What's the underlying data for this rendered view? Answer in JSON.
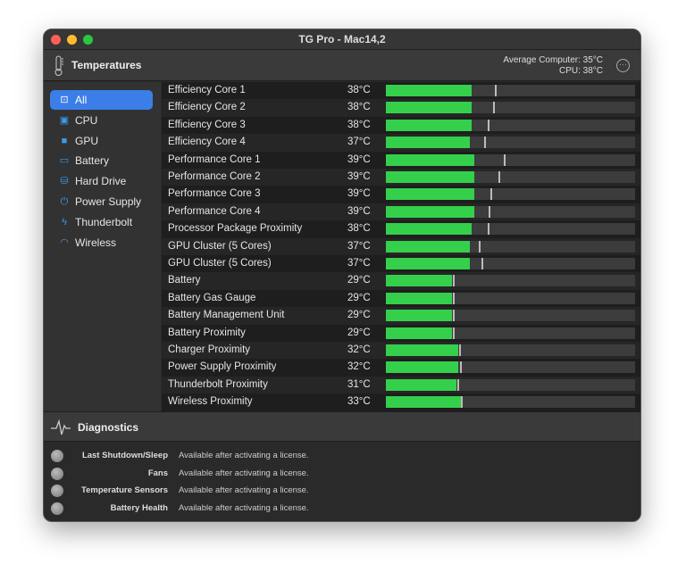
{
  "window": {
    "title": "TG Pro - Mac14,2"
  },
  "header": {
    "title": "Temperatures",
    "avg_label": "Average Computer:",
    "avg_value": "35°C",
    "cpu_label": "CPU:",
    "cpu_value": "38°C",
    "more_icon": "ellipsis-circle-icon"
  },
  "sidebar": {
    "items": [
      {
        "label": "All",
        "icon": "all-icon",
        "selected": true
      },
      {
        "label": "CPU",
        "icon": "cpu-icon"
      },
      {
        "label": "GPU",
        "icon": "gpu-icon"
      },
      {
        "label": "Battery",
        "icon": "battery-icon"
      },
      {
        "label": "Hard Drive",
        "icon": "hard-drive-icon"
      },
      {
        "label": "Power Supply",
        "icon": "power-icon"
      },
      {
        "label": "Thunderbolt",
        "icon": "thunderbolt-icon"
      },
      {
        "label": "Wireless",
        "icon": "wifi-icon"
      }
    ]
  },
  "scale_max_c": 110,
  "sensors": [
    {
      "name": "Efficiency Core 1",
      "value": "38°C",
      "temp": 38,
      "max": 48
    },
    {
      "name": "Efficiency Core 2",
      "value": "38°C",
      "temp": 38,
      "max": 47.5
    },
    {
      "name": "Efficiency Core 3",
      "value": "38°C",
      "temp": 38,
      "max": 45
    },
    {
      "name": "Efficiency Core 4",
      "value": "37°C",
      "temp": 37,
      "max": 43.5
    },
    {
      "name": "Performance Core 1",
      "value": "39°C",
      "temp": 39,
      "max": 52
    },
    {
      "name": "Performance Core 2",
      "value": "39°C",
      "temp": 39,
      "max": 49.5
    },
    {
      "name": "Performance Core 3",
      "value": "39°C",
      "temp": 39,
      "max": 46
    },
    {
      "name": "Performance Core 4",
      "value": "39°C",
      "temp": 39,
      "max": 45.5
    },
    {
      "name": "Processor Package Proximity",
      "value": "38°C",
      "temp": 38,
      "max": 45
    },
    {
      "name": "GPU Cluster (5 Cores)",
      "value": "37°C",
      "temp": 37,
      "max": 41
    },
    {
      "name": "GPU Cluster (5 Cores)",
      "value": "37°C",
      "temp": 37,
      "max": 42
    },
    {
      "name": "Battery",
      "value": "29°C",
      "temp": 29,
      "max": 29.5
    },
    {
      "name": "Battery Gas Gauge",
      "value": "29°C",
      "temp": 29,
      "max": 29.5
    },
    {
      "name": "Battery Management Unit",
      "value": "29°C",
      "temp": 29,
      "max": 29.5
    },
    {
      "name": "Battery Proximity",
      "value": "29°C",
      "temp": 29,
      "max": 29.5
    },
    {
      "name": "Charger Proximity",
      "value": "32°C",
      "temp": 32,
      "max": 32.3
    },
    {
      "name": "Power Supply Proximity",
      "value": "32°C",
      "temp": 32,
      "max": 32.7
    },
    {
      "name": "Thunderbolt Proximity",
      "value": "31°C",
      "temp": 31,
      "max": 31.5
    },
    {
      "name": "Wireless Proximity",
      "value": "33°C",
      "temp": 33,
      "max": 33.3
    }
  ],
  "diagnostics": {
    "title": "Diagnostics",
    "items": [
      {
        "label": "Last Shutdown/Sleep",
        "value": "Available after activating a license."
      },
      {
        "label": "Fans",
        "value": "Available after activating a license."
      },
      {
        "label": "Temperature Sensors",
        "value": "Available after activating a license."
      },
      {
        "label": "Battery Health",
        "value": "Available after activating a license."
      }
    ]
  },
  "colors": {
    "accent": "#3b7ee8",
    "bar": "#34d04c",
    "close": "#fe5f57",
    "min": "#febc2e",
    "max": "#28c840"
  }
}
